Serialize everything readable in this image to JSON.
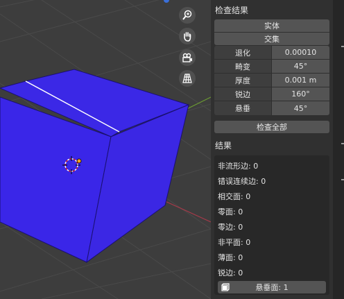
{
  "panel": {
    "title": "检查结果",
    "solid_btn": "实体",
    "intersect_btn": "交集",
    "params": [
      {
        "label": "退化",
        "value": "0.00010"
      },
      {
        "label": "畸变",
        "value": "45°"
      },
      {
        "label": "厚度",
        "value": "0.001 m"
      },
      {
        "label": "锐边",
        "value": "160°"
      },
      {
        "label": "悬垂",
        "value": "45°"
      }
    ],
    "check_all_btn": "检查全部",
    "results_title": "结果",
    "results": [
      "非流形边: 0",
      "错误连续边: 0",
      "相交面: 0",
      "零面: 0",
      "零边: 0",
      "非平面: 0",
      "薄面: 0",
      "锐边: 0"
    ],
    "overhang_btn": "悬垂面: 1"
  },
  "colors": {
    "mesh": "#3b28e6",
    "viewport_bg": "#3d3d3d",
    "panel_bg": "#303030",
    "axis_x": "#a83a4a",
    "axis_y": "#6b9a32"
  },
  "nav_icons": [
    "zoom-icon",
    "hand-pan-icon",
    "camera-icon",
    "grid-view-icon"
  ]
}
